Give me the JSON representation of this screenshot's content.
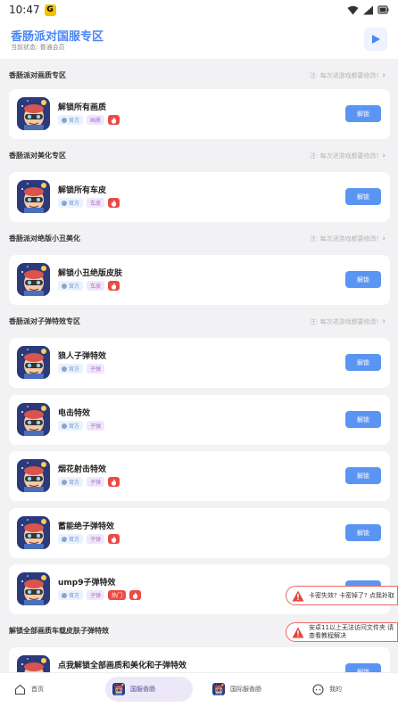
{
  "status_bar": {
    "time": "10:47",
    "app_badge": "G"
  },
  "header": {
    "title": "香肠派对国服专区",
    "subtitle": "当前状态: 普通会员",
    "play_icon": "play-icon"
  },
  "sections": [
    {
      "title": "香肠派对画质专区",
      "note": "注: 每次进游戏都要修改!"
    },
    {
      "title": "香肠派对美化专区",
      "note": "注: 每次进游戏都要修改!"
    },
    {
      "title": "香肠派对绝版小丑美化",
      "note": "注: 每次进游戏都要修改!"
    },
    {
      "title": "香肠派对子弹特效专区",
      "note": "注: 每次进游戏都要修改!"
    },
    {
      "title": "解锁全部画质车载皮肤子弹特效",
      "note": ""
    }
  ],
  "cards": [
    {
      "name": "解锁所有画质",
      "official": "官方",
      "type": "画质",
      "type_style": "purple",
      "hot": true,
      "popular": ""
    },
    {
      "name": "解锁所有车皮",
      "official": "官方",
      "type": "车皮",
      "type_style": "purple",
      "hot": true,
      "popular": ""
    },
    {
      "name": "解锁小丑绝版皮肤",
      "official": "官方",
      "type": "车皮",
      "type_style": "purple",
      "hot": true,
      "popular": ""
    },
    {
      "name": "狼人子弹特效",
      "official": "官方",
      "type": "子弹",
      "type_style": "purple",
      "hot": false,
      "popular": ""
    },
    {
      "name": "电击特效",
      "official": "官方",
      "type": "子弹",
      "type_style": "purple",
      "hot": false,
      "popular": ""
    },
    {
      "name": "烟花射击特效",
      "official": "官方",
      "type": "子弹",
      "type_style": "purple",
      "hot": true,
      "popular": ""
    },
    {
      "name": "蓄能绝子弹特效",
      "official": "官方",
      "type": "子弹",
      "type_style": "purple",
      "hot": true,
      "popular": ""
    },
    {
      "name": "ump9子弹特效",
      "official": "官方",
      "type": "子弹",
      "type_style": "purple",
      "hot": true,
      "popular": "热门"
    },
    {
      "name": "点我解锁全部画质和美化和子弹特效",
      "official": "",
      "type": "",
      "type_style": "purple",
      "hot": false,
      "popular": ""
    }
  ],
  "unlock_label": "解锁",
  "toasts": [
    {
      "text": "卡密失效? 卡密掉了? 点我补取"
    },
    {
      "text": "安卓11以上无法访问文件夹 请查看教程解决"
    }
  ],
  "tabbar": [
    {
      "label": "首页",
      "icon": "home-icon",
      "active": false
    },
    {
      "label": "国服香肠",
      "icon": "game-icon",
      "active": true
    },
    {
      "label": "国际服香肠",
      "icon": "game-icon",
      "active": false
    },
    {
      "label": "我的",
      "icon": "profile-icon",
      "active": false
    }
  ],
  "colors": {
    "accent": "#5b95f3",
    "title": "#4a86f7",
    "hot": "#ea4b43"
  }
}
